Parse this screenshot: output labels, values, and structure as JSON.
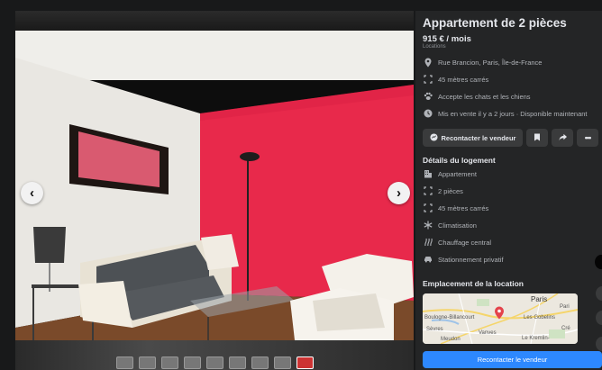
{
  "listing": {
    "title": "Appartement de 2 pièces",
    "price": "915 € / mois",
    "price_subtitle": "Locations",
    "details": [
      {
        "icon": "location-pin-icon",
        "text": "Rue Brancion, Paris, Île-de-France"
      },
      {
        "icon": "area-icon",
        "text": "45 mètres carrés"
      },
      {
        "icon": "paw-icon",
        "text": "Accepte les chats et les chiens"
      },
      {
        "icon": "clock-icon",
        "text": "Mis en vente il y a 2 jours · Disponible maintenant"
      }
    ]
  },
  "actions": {
    "contact_label": "Recontacter le vendeur"
  },
  "housing": {
    "title": "Détails du logement",
    "items": [
      {
        "icon": "building-icon",
        "text": "Appartement"
      },
      {
        "icon": "rooms-icon",
        "text": "2 pièces"
      },
      {
        "icon": "area-icon",
        "text": "45 mètres carrés"
      },
      {
        "icon": "snowflake-icon",
        "text": "Climatisation"
      },
      {
        "icon": "heating-icon",
        "text": "Chauffage central"
      },
      {
        "icon": "car-icon",
        "text": "Stationnement privatif"
      }
    ]
  },
  "location": {
    "title": "Emplacement de la location",
    "map_labels": [
      "Paris",
      "Boulogne-Billancourt",
      "Sèvres",
      "Vanves",
      "Meudon",
      "Les Gobelins",
      "Le Kremlin-",
      "Pari",
      "Cré"
    ]
  },
  "cta": {
    "label": "Recontacter le vendeur"
  },
  "colors": {
    "panel_bg": "#242526",
    "accent": "#2d88ff",
    "wall_red": "#e8294b"
  }
}
